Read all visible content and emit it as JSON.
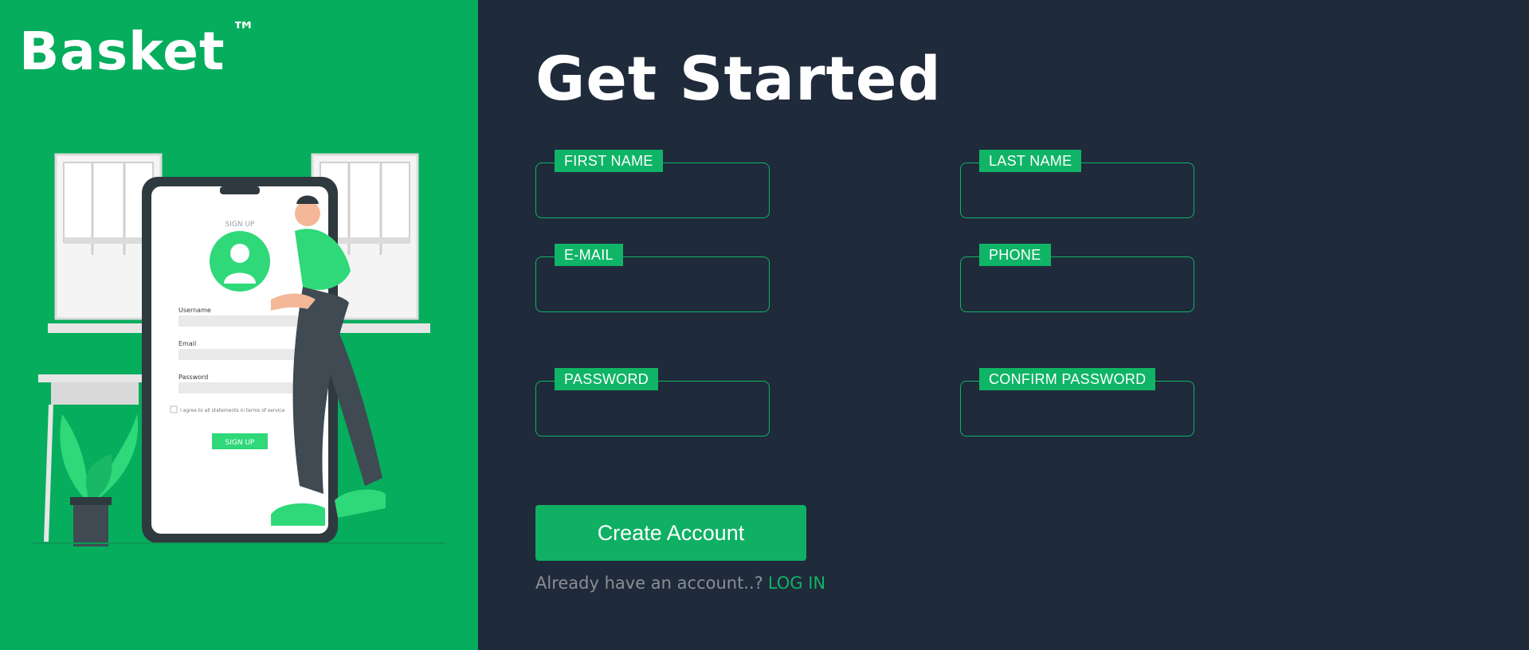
{
  "brand": {
    "name": "Basket",
    "trademark": "™"
  },
  "illustration": {
    "screen_title": "SIGN UP",
    "labels": [
      "Username",
      "Email",
      "Password"
    ],
    "agree_text": "I agree to all statements in terms of service",
    "button_label": "SIGN UP"
  },
  "form": {
    "title": "Get Started",
    "fields": {
      "first_name": {
        "label": "FIRST NAME",
        "value": ""
      },
      "last_name": {
        "label": "LAST NAME",
        "value": ""
      },
      "email": {
        "label": "E-MAIL",
        "value": ""
      },
      "phone": {
        "label": "PHONE",
        "value": ""
      },
      "password": {
        "label": "PASSWORD",
        "value": ""
      },
      "confirm_password": {
        "label": "CONFIRM PASSWORD",
        "value": ""
      }
    },
    "submit_label": "Create Account",
    "login_prompt": "Already have an account..?",
    "login_link": "LOG IN"
  },
  "colors": {
    "left_bg": "#05ad5d",
    "right_bg": "#1f2a3b",
    "accent": "#10b466",
    "muted_text": "#8b8f94"
  }
}
